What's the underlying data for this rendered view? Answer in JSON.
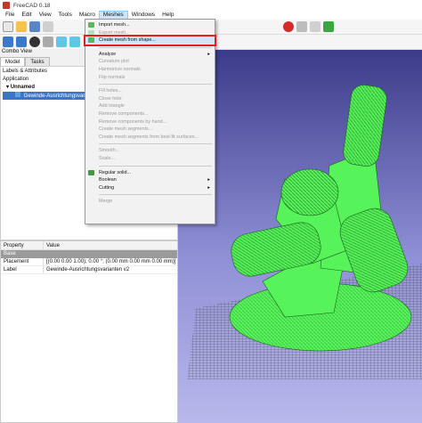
{
  "app": {
    "title": "FreeCAD 0.18"
  },
  "menubar": [
    "File",
    "Edit",
    "View",
    "Tools",
    "Macro",
    "Meshes",
    "Windows",
    "Help"
  ],
  "combo": {
    "title": "Combo View",
    "tabs": [
      "Model",
      "Tasks"
    ]
  },
  "tree": {
    "header": "Labels & Attributes",
    "root": "Application",
    "doc": "Unnamed",
    "item": "Gewinde-Ausrichtungsvarianten"
  },
  "props": {
    "col_property": "Property",
    "col_value": "Value",
    "group": "Base",
    "rows": [
      {
        "name": "Placement",
        "value": "[(0.00 0.00 1.00); 0.00 °; (0.00 mm 0.00 mm 0.00 mm)]"
      },
      {
        "name": "Label",
        "value": "Gewinde-Ausrichtungsvarianten v2"
      }
    ]
  },
  "menu": {
    "g1": [
      "Import mesh...",
      "Export mesh...",
      "Create mesh from shape..."
    ],
    "analyze": "Analyze",
    "g2": [
      "Curvature plot",
      "Harmonize normals",
      "Flip normals"
    ],
    "g3": [
      "Fill holes...",
      "Close hole",
      "Add triangle",
      "Remove components...",
      "Remove components by hand...",
      "Create mesh segments...",
      "Create mesh segments from best-fit surfaces..."
    ],
    "g4": [
      "Smooth...",
      "Scale..."
    ],
    "regular": "Regular solid...",
    "boolean": "Boolean",
    "cutting": "Cutting",
    "merge": "Merge"
  },
  "colors": {
    "mesh": "#57f35a",
    "highlight_border": "#e0201e",
    "tree_selection": "#3d74c6"
  }
}
